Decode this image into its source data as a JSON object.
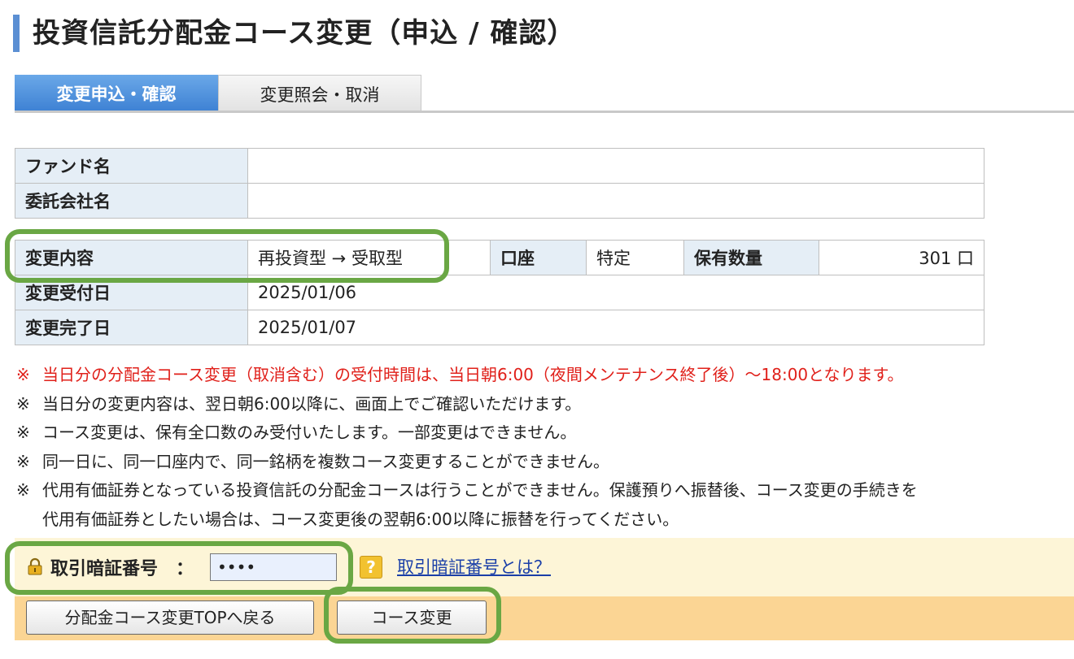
{
  "header": {
    "title": "投資信託分配金コース変更（申込 / 確認）"
  },
  "tabs": [
    {
      "label": "変更申込・確認",
      "active": true
    },
    {
      "label": "変更照会・取消",
      "active": false
    }
  ],
  "fund_table": {
    "fund_name_label": "ファンド名",
    "fund_name_value": "",
    "company_label": "委託会社名",
    "company_value": ""
  },
  "change_table": {
    "content_label": "変更内容",
    "content_value": "再投資型 → 受取型",
    "account_label": "口座",
    "account_value": "特定",
    "holding_label": "保有数量",
    "holding_value": "301 口",
    "accept_date_label": "変更受付日",
    "accept_date_value": "2025/01/06",
    "complete_date_label": "変更完了日",
    "complete_date_value": "2025/01/07"
  },
  "notes": {
    "mark": "※",
    "n1": "当日分の分配金コース変更（取消含む）の受付時間は、当日朝6:00（夜間メンテナンス終了後）〜18:00となります。",
    "n2": "当日分の変更内容は、翌日朝6:00以降に、画面上でご確認いただけます。",
    "n3": "コース変更は、保有全口数のみ受付いたします。一部変更はできません。",
    "n4": "同一日に、同一口座内で、同一銘柄を複数コース変更することができません。",
    "n5": "代用有価証券となっている投資信託の分配金コースは行うことができません。保護預りへ振替後、コース変更の手続きを",
    "n5_cont": "代用有価証券としたい場合は、コース変更後の翌朝6:00以降に振替を行ってください。"
  },
  "password": {
    "label": "取引暗証番号　：",
    "value": "••••",
    "help_icon": "?",
    "help_link": "取引暗証番号とは？"
  },
  "buttons": {
    "back": "分配金コース変更TOPへ戻る",
    "change": "コース変更"
  },
  "colors": {
    "accent_blue": "#5b8fd3",
    "warning_red": "#e0201a",
    "highlight_green": "#6aa744"
  }
}
